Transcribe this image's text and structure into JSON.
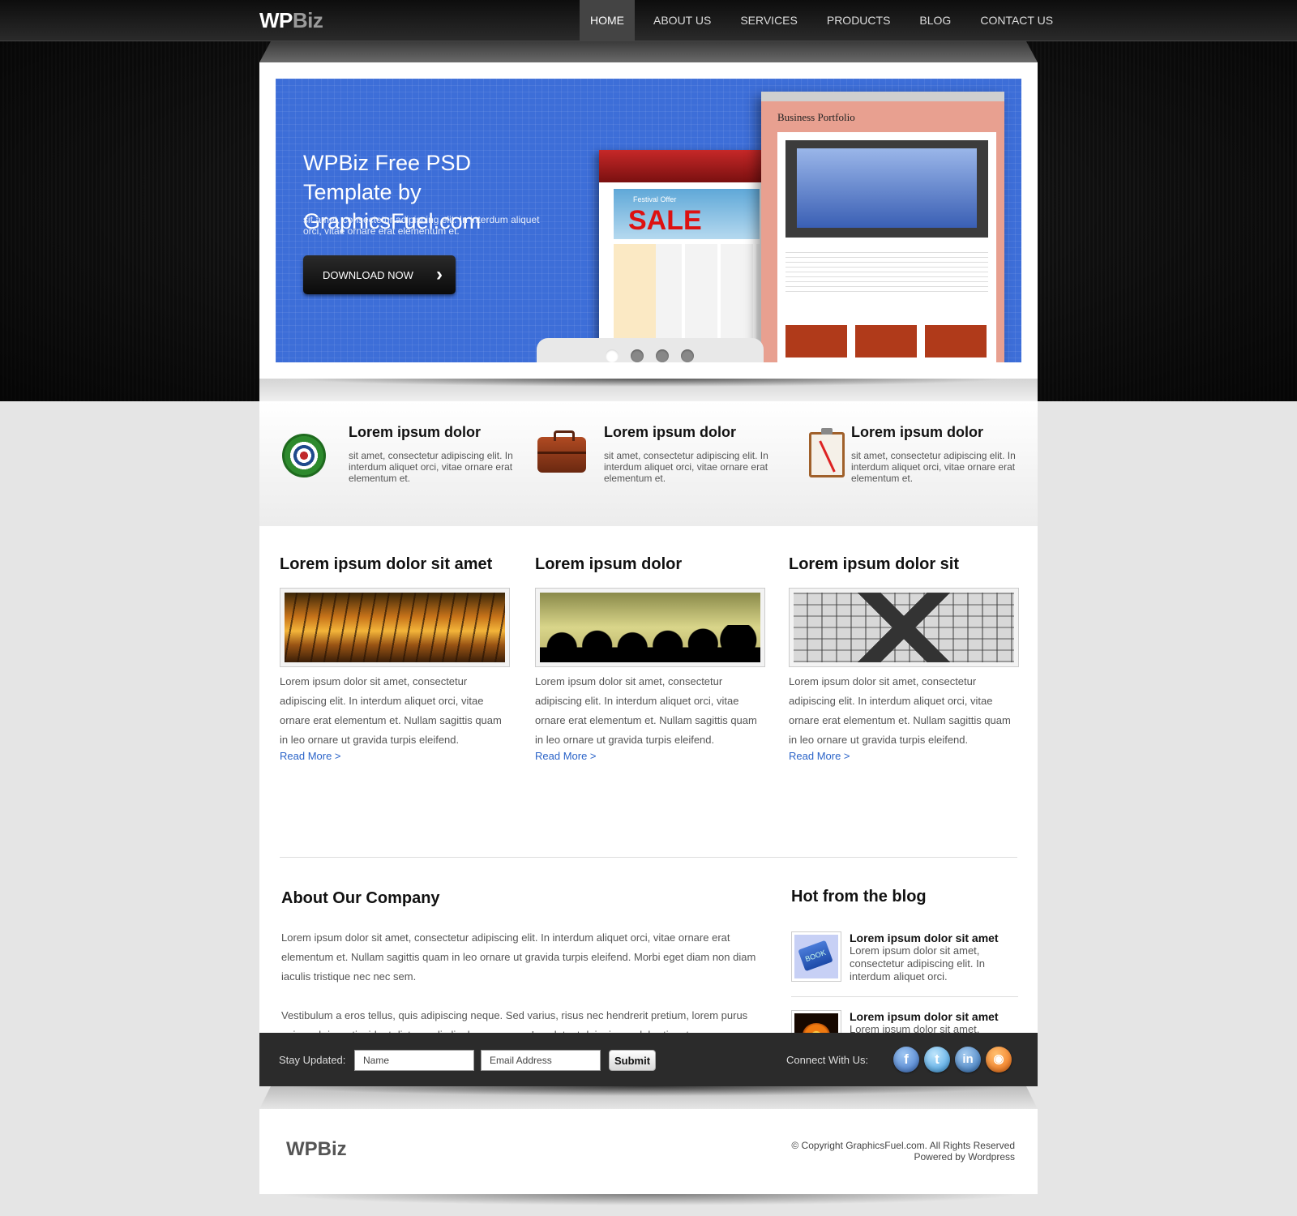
{
  "header": {
    "logo_main": "WP",
    "logo_accent": "Biz",
    "nav": [
      "HOME",
      "ABOUT US",
      "SERVICES",
      "PRODUCTS",
      "BLOG",
      "CONTACT US"
    ],
    "active_nav": "HOME"
  },
  "hero": {
    "title": "WPBiz Free PSD Template by GraphicsFuel.com",
    "text": "sit amet, consectetur adipiscing elit. In interdum aliquet orci, vitae ornare erat elementum et.",
    "button_label": "DOWNLOAD NOW",
    "button_icon": "chevron-right-icon",
    "mockup_left": {
      "offer": "Festival Offer",
      "sale": "SALE"
    },
    "mockup_right": {
      "title": "Business Portfolio"
    },
    "slides": 4,
    "active_slide": 1,
    "background_color": "#3d6ed8"
  },
  "features": [
    {
      "icon": "target-icon",
      "title": "Lorem ipsum dolor",
      "text": "sit amet, consectetur adipiscing elit. In interdum aliquet orci, vitae ornare erat elementum et."
    },
    {
      "icon": "briefcase-icon",
      "title": "Lorem ipsum dolor",
      "text": "sit amet, consectetur adipiscing elit. In interdum aliquet orci, vitae ornare erat elementum et."
    },
    {
      "icon": "clipboard-icon",
      "title": "Lorem ipsum dolor",
      "text": "sit amet, consectetur adipiscing elit. In interdum aliquet orci, vitae ornare erat elementum et."
    }
  ],
  "articles": [
    {
      "title": "Lorem ipsum dolor sit amet",
      "image": "sunset-grass-image",
      "text": "Lorem ipsum dolor sit amet, consectetur adipiscing elit. In interdum aliquet orci, vitae ornare erat elementum et. Nullam sagittis quam in leo ornare ut gravida turpis eleifend.",
      "link": "Read More >"
    },
    {
      "title": "Lorem ipsum dolor",
      "image": "crowd-silhouette-image",
      "text": "Lorem ipsum dolor sit amet, consectetur adipiscing elit. In interdum aliquet orci, vitae ornare erat elementum et. Nullam sagittis quam in leo ornare ut gravida turpis eleifend.",
      "link": "Read More >"
    },
    {
      "title": "Lorem ipsum dolor sit",
      "image": "glass-roof-image",
      "text": "Lorem ipsum dolor sit amet, consectetur adipiscing elit. In interdum aliquet orci, vitae ornare erat elementum et. Nullam sagittis quam in leo ornare ut gravida turpis eleifend.",
      "link": "Read More >"
    }
  ],
  "about": {
    "title": "About Our Company",
    "paragraphs": [
      "Lorem ipsum dolor sit amet, consectetur adipiscing elit. In interdum aliquet orci, vitae ornare erat elementum et. Nullam sagittis quam in leo ornare ut gravida turpis eleifend. Morbi eget diam non diam iaculis tristique nec nec sem.",
      "Vestibulum a eros tellus, quis adipiscing neque. Sed varius, risus nec hendrerit pretium, lorem purus euismod risus, tincidunt dictum odio ligula non purus. In volutpat dui a ipsum lobortis rutrum. Pellentesque commodo aliquam pulvinar. In erat risus, molestie vitae porta molestie, pulvinar non justo."
    ]
  },
  "blog": {
    "title": "Hot from the blog",
    "posts": [
      {
        "icon": "book-icon",
        "title": "Lorem ipsum dolor sit amet",
        "text": "Lorem ipsum dolor sit amet, consectetur adipiscing elit. In interdum aliquet orci."
      },
      {
        "icon": "pumpkin-icon",
        "title": "Lorem ipsum dolor sit amet",
        "text": "Lorem ipsum dolor sit amet, consectetur adipiscing elit. In interdum aliquet orci."
      }
    ]
  },
  "newsletter": {
    "label": "Stay Updated:",
    "name_placeholder": "Name",
    "email_placeholder": "Email Address",
    "submit_label": "Submit",
    "connect_label": "Connect With Us:",
    "social": [
      {
        "icon": "facebook-icon",
        "glyph": "f"
      },
      {
        "icon": "twitter-icon",
        "glyph": "t"
      },
      {
        "icon": "linkedin-icon",
        "glyph": "in"
      },
      {
        "icon": "rss-icon",
        "glyph": "◉"
      }
    ]
  },
  "footer": {
    "logo": "WPBiz",
    "copyright": "© Copyright GraphicsFuel.com. All Rights Reserved",
    "powered": "Powered by Wordpress"
  }
}
